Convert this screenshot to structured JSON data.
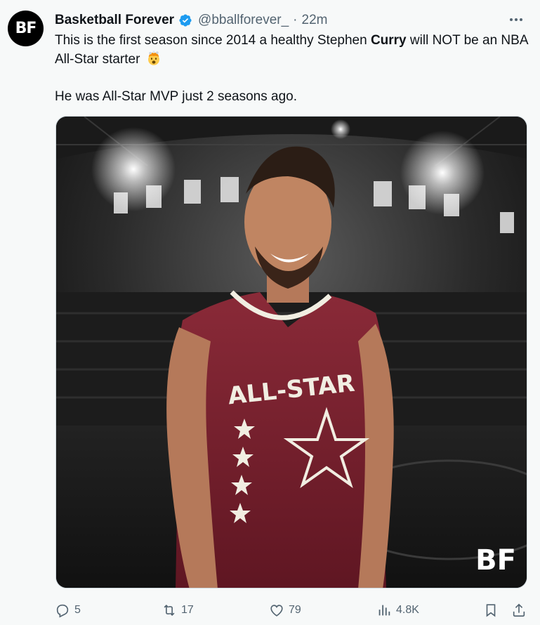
{
  "author": {
    "name": "Basketball Forever",
    "handle": "@bballforever_",
    "separator": "·",
    "time": "22m",
    "avatar_text": "BF"
  },
  "tweet": {
    "line1_pre": "This is the first season since 2014 a healthy Stephen ",
    "line1_bold": "Curry",
    "line1_post": " will NOT be an NBA All-Star starter",
    "emoji": "exploding-head-emoji",
    "line2": "He was All-Star MVP just 2 seasons ago."
  },
  "media": {
    "jersey_text": "ALL-STAR",
    "watermark": "BF"
  },
  "actions": {
    "replies": "5",
    "reposts": "17",
    "likes": "79",
    "views": "4.8K"
  },
  "colors": {
    "verified": "#1d9bf0",
    "muted": "#536471",
    "jersey": "#7a1f2e"
  }
}
